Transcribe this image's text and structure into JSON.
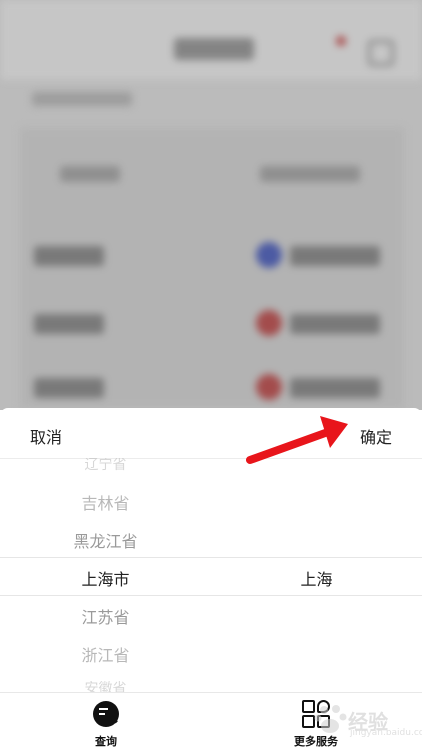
{
  "picker": {
    "cancel_label": "取消",
    "confirm_label": "确定",
    "provinces": [
      "辽宁省",
      "吉林省",
      "黑龙江省",
      "上海市",
      "江苏省",
      "浙江省",
      "安徽省"
    ],
    "selected_province": "上海市",
    "cities": [
      "上海"
    ],
    "selected_city": "上海"
  },
  "tabbar": {
    "tabs": [
      {
        "label": "查询",
        "icon": "search-list-icon"
      },
      {
        "label": "更多服务",
        "icon": "grid-services-icon"
      }
    ]
  },
  "annotation": {
    "arrow_color": "#e8151b"
  },
  "watermark": {
    "text": "经验",
    "sub": "jingyan.baidu.com"
  }
}
